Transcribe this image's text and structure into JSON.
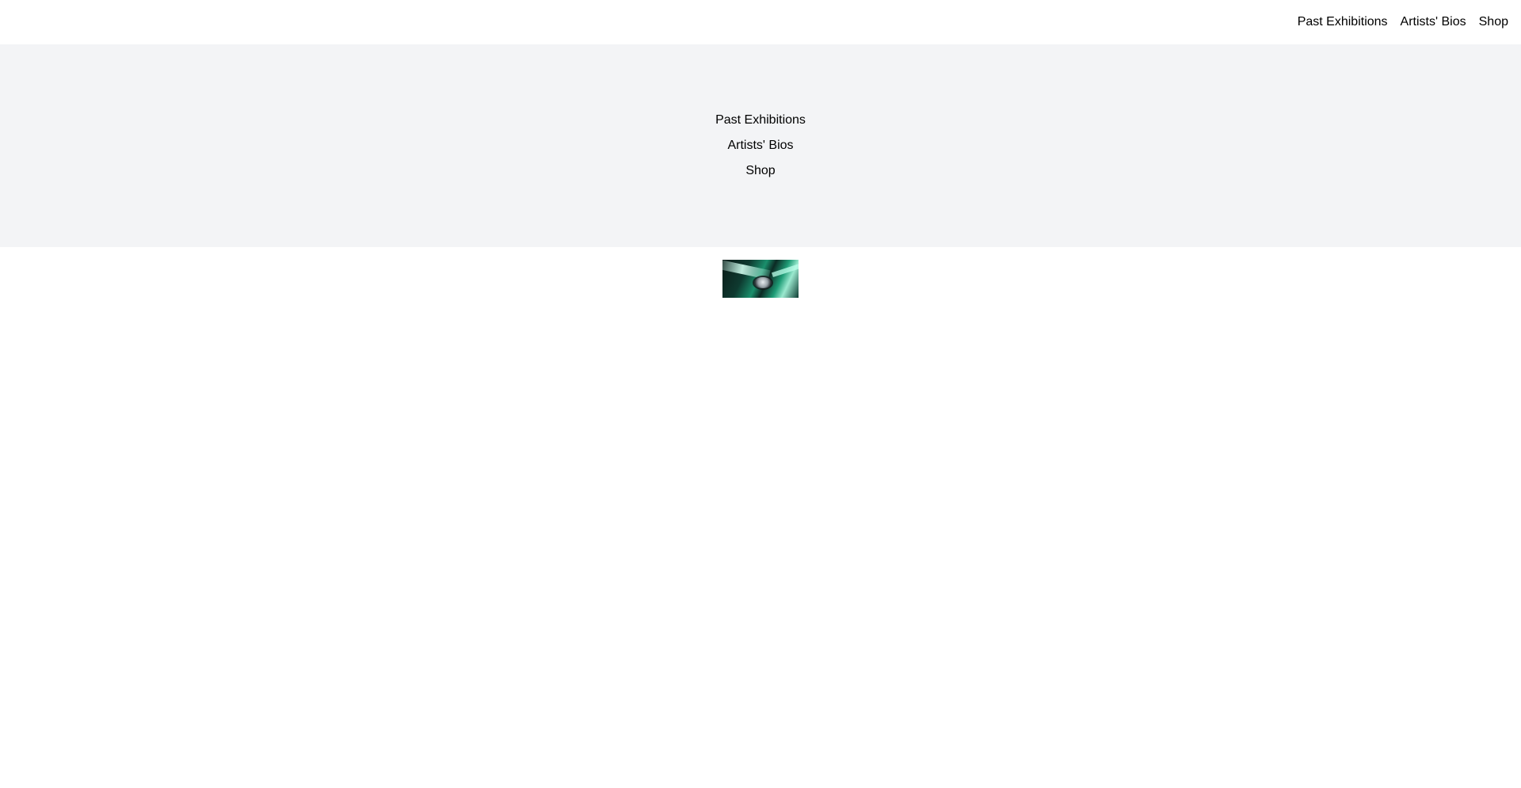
{
  "header": {
    "nav": [
      {
        "label": "Past Exhibitions"
      },
      {
        "label": "Artists' Bios"
      },
      {
        "label": "Shop"
      }
    ]
  },
  "hero": {
    "links": [
      {
        "label": "Past Exhibitions"
      },
      {
        "label": "Artists' Bios"
      },
      {
        "label": "Shop"
      }
    ],
    "background": "#f3f4f6"
  },
  "image": {
    "description_icon": "artwork-thumbnail",
    "accent_colors": [
      "#0e3a30",
      "#1a8f6c",
      "#9be9cf"
    ]
  }
}
